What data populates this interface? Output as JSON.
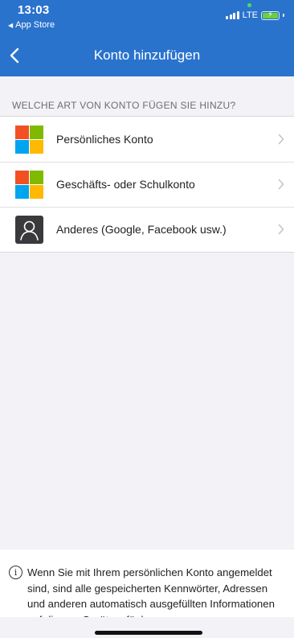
{
  "status_bar": {
    "time": "13:03",
    "back_app": "App Store",
    "network": "LTE"
  },
  "nav": {
    "title": "Konto hinzufügen"
  },
  "section_header": "WELCHE ART VON KONTO FÜGEN SIE HINZU?",
  "account_types": [
    {
      "label": "Persönliches Konto",
      "icon": "microsoft-logo-icon"
    },
    {
      "label": "Geschäfts- oder Schulkonto",
      "icon": "microsoft-logo-icon"
    },
    {
      "label": "Anderes (Google, Facebook usw.)",
      "icon": "person-icon"
    }
  ],
  "footer": {
    "text": "Wenn Sie mit Ihrem persönlichen Konto angemeldet sind, sind alle gespeicherten Kennwörter, Adressen und anderen automatisch ausgefüllten Informationen auf diesem Gerät verfügbar."
  },
  "colors": {
    "header_bg": "#2a73cd",
    "page_bg": "#f2f2f7",
    "ms_red": "#f25022",
    "ms_green": "#7fba00",
    "ms_blue": "#00a4ef",
    "ms_yellow": "#ffb900"
  }
}
